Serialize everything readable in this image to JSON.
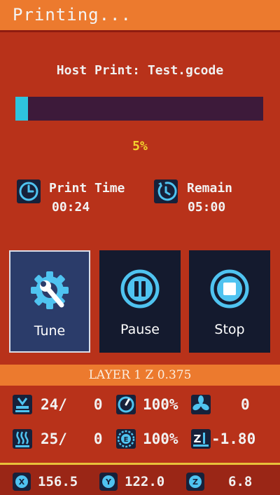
{
  "header": {
    "title": "Printing..."
  },
  "print": {
    "host_title": "Host Print: Test.gcode",
    "progress_percent": 5,
    "percent_label": "5%"
  },
  "time": {
    "elapsed_label": "Print Time",
    "elapsed_value": "00:24",
    "remain_label": "Remain",
    "remain_value": "05:00"
  },
  "buttons": {
    "tune": {
      "label": "Tune",
      "icon": "gear-wrench-icon"
    },
    "pause": {
      "label": "Pause",
      "icon": "pause-icon"
    },
    "stop": {
      "label": "Stop",
      "icon": "stop-icon"
    }
  },
  "layer": {
    "text": "LAYER 1 Z 0.375"
  },
  "stats": {
    "bed_temp": "24/   0",
    "feedrate": "100%",
    "fan": "0",
    "nozzle_temp": "25/   0",
    "flow": "100%",
    "z_offset": "-1.80"
  },
  "position": {
    "x": "156.5",
    "y": "122.0",
    "z": "6.8"
  },
  "colors": {
    "header": "#ec7a2e",
    "background": "#b8321a",
    "accent": "#2ec4de",
    "percent": "#f3d32d"
  }
}
